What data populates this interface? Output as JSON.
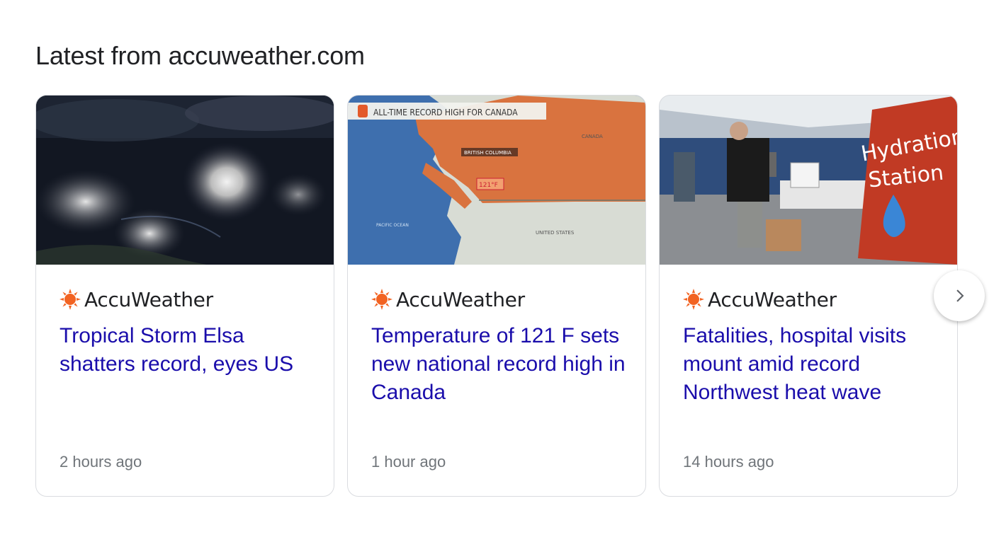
{
  "section": {
    "title": "Latest from accuweather.com"
  },
  "cards": [
    {
      "source": "AccuWeather",
      "headline": "Tropical Storm Elsa shatters record, eyes US",
      "timestamp": "2 hours ago",
      "image": "satellite-storm-image"
    },
    {
      "source": "AccuWeather",
      "headline": "Temperature of 121 F sets new national record high in Canada",
      "timestamp": "1 hour ago",
      "image": "canada-record-map-image",
      "image_text": {
        "banner": "ALL-TIME RECORD HIGH FOR CANADA",
        "region": "BRITISH COLUMBIA",
        "country": "CANADA",
        "country2": "UNITED STATES",
        "ocean": "PACIFIC OCEAN",
        "value": "121°F"
      }
    },
    {
      "source": "AccuWeather",
      "headline": "Fatalities, hospital visits mount amid record Northwest heat wave",
      "timestamp": "14 hours ago",
      "image": "hydration-station-photo",
      "image_text": {
        "sign_line1": "Hydration",
        "sign_line2": "Station"
      }
    }
  ],
  "colors": {
    "link": "#1a0dab",
    "meta": "#70757a",
    "title": "#202124",
    "logo": "#f26322",
    "border": "#dadce0"
  },
  "icons": {
    "logo": "accuweather-sun-icon",
    "next": "chevron-right-icon"
  }
}
